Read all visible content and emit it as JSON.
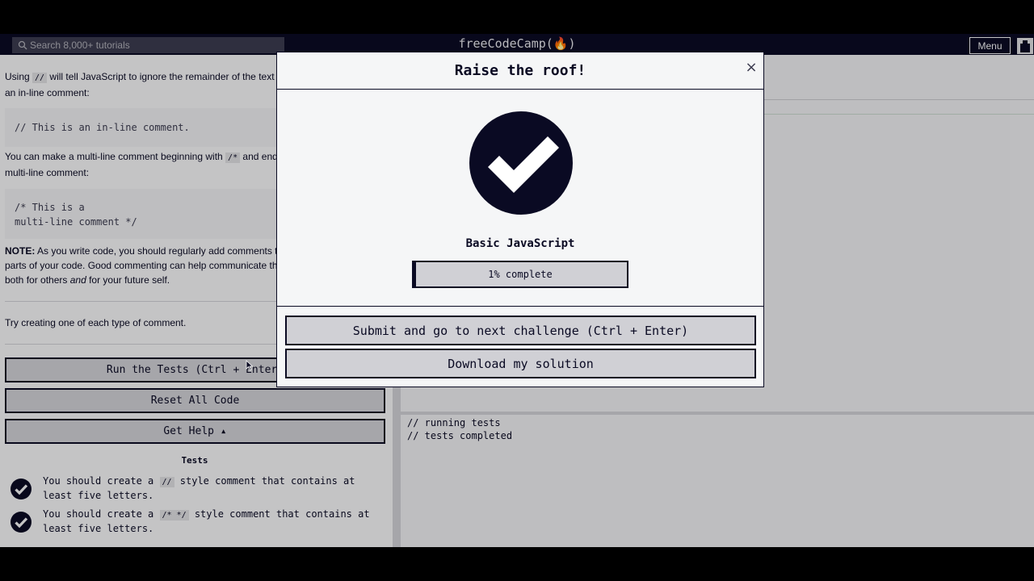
{
  "nav": {
    "search_placeholder": "Search 8,000+ tutorials",
    "logo": "freeCodeCamp(ὒ5)",
    "logo_text": "freeCodeCamp(🔥)",
    "menu_label": "Menu"
  },
  "lesson": {
    "p1_a": "Using ",
    "p1_code": "//",
    "p1_b": " will tell JavaScript to ignore the remainder of the text o",
    "p1_c": "an in-line comment:",
    "code1": "// This is an in-line comment.",
    "p2_a": "You can make a multi-line comment beginning with ",
    "p2_code": "/*",
    "p2_b": " and endi",
    "p2_c": "multi-line comment:",
    "code2_line1": "/* This is a",
    "code2_line2": "multi-line comment */",
    "note_bold": "NOTE:",
    "note_1": " As you write code, you should regularly add comments to",
    "note_2": "parts of your code. Good commenting can help communicate the",
    "note_3a": "both for others ",
    "note_3i": "and",
    "note_3b": " for your future self.",
    "task": "Try creating one of each type of comment."
  },
  "buttons": {
    "run_tests": "Run the Tests (Ctrl + Enter)",
    "reset": "Reset All Code",
    "help": "Get Help ▴"
  },
  "tests": {
    "heading": "Tests",
    "items": [
      {
        "a": "You should create a ",
        "code": "//",
        "b": " style comment that contains at",
        "c": "least five letters."
      },
      {
        "a": "You should create a ",
        "code": "/* */",
        "b": " style comment that contains at",
        "c": "least five letters."
      }
    ]
  },
  "console": {
    "line1": "// running tests",
    "line2": "// tests completed"
  },
  "modal": {
    "title": "Raise the roof!",
    "close": "×",
    "cert_name": "Basic JavaScript",
    "progress_label": "1% complete",
    "progress_fraction": 0.01,
    "submit_label": "Submit and go to next challenge (Ctrl + Enter)",
    "download_label": "Download my solution"
  },
  "colors": {
    "navy": "#0a0a23",
    "light": "#f5f6f7",
    "gray": "#d0d0d5"
  }
}
